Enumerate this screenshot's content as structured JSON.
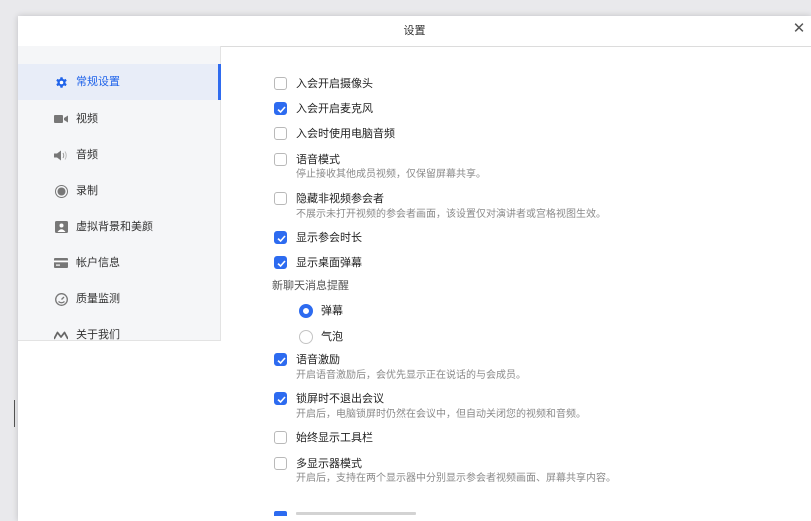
{
  "window": {
    "title": "设置",
    "close_glyph": "✕"
  },
  "sidebar": {
    "items": [
      {
        "label": "常规设置",
        "icon": "gear-icon",
        "active": true
      },
      {
        "label": "视频",
        "icon": "video-icon"
      },
      {
        "label": "音频",
        "icon": "speaker-icon"
      },
      {
        "label": "录制",
        "icon": "record-icon"
      },
      {
        "label": "虚拟背景和美颜",
        "icon": "portrait-icon"
      },
      {
        "label": "帐户信息",
        "icon": "card-icon"
      },
      {
        "label": "质量监测",
        "icon": "gauge-icon"
      },
      {
        "label": "关于我们",
        "icon": "about-icon"
      }
    ]
  },
  "settings": {
    "camera_on_join": {
      "label": "入会开启摄像头",
      "checked": false
    },
    "mic_on_join": {
      "label": "入会开启麦克风",
      "checked": true
    },
    "computer_audio": {
      "label": "入会时使用电脑音频",
      "checked": false
    },
    "voice_mode": {
      "label": "语音模式",
      "desc": "停止接收其他成员视频，仅保留屏幕共享。",
      "checked": false
    },
    "hide_non_video": {
      "label": "隐藏非视频参会者",
      "desc": "不展示未打开视频的参会者画面，该设置仅对演讲者或宫格视图生效。",
      "checked": false
    },
    "show_duration": {
      "label": "显示参会时长",
      "checked": true
    },
    "show_danmaku": {
      "label": "显示桌面弹幕",
      "checked": true
    },
    "chat_reminder": {
      "title": "新聊天消息提醒",
      "options": [
        {
          "label": "弹幕",
          "selected": true
        },
        {
          "label": "气泡",
          "selected": false
        }
      ]
    },
    "voice_excite": {
      "label": "语音激励",
      "desc": "开启语音激励后，会优先显示正在说话的与会成员。",
      "checked": true
    },
    "stay_on_lock": {
      "label": "锁屏时不退出会议",
      "desc": "开启后，电脑锁屏时仍然在会议中，但自动关闭您的视频和音频。",
      "checked": true
    },
    "always_toolbar": {
      "label": "始终显示工具栏",
      "checked": false
    },
    "multi_display": {
      "label": "多显示器模式",
      "desc": "开启后，支持在两个显示器中分别显示参会者视频画面、屏幕共享内容。",
      "checked": false
    }
  },
  "colors": {
    "accent": "#2d6bf0",
    "sidebar_bg": "#f5f6f8",
    "active_bg": "#e8edf8",
    "muted_text": "#8a8a8a"
  }
}
